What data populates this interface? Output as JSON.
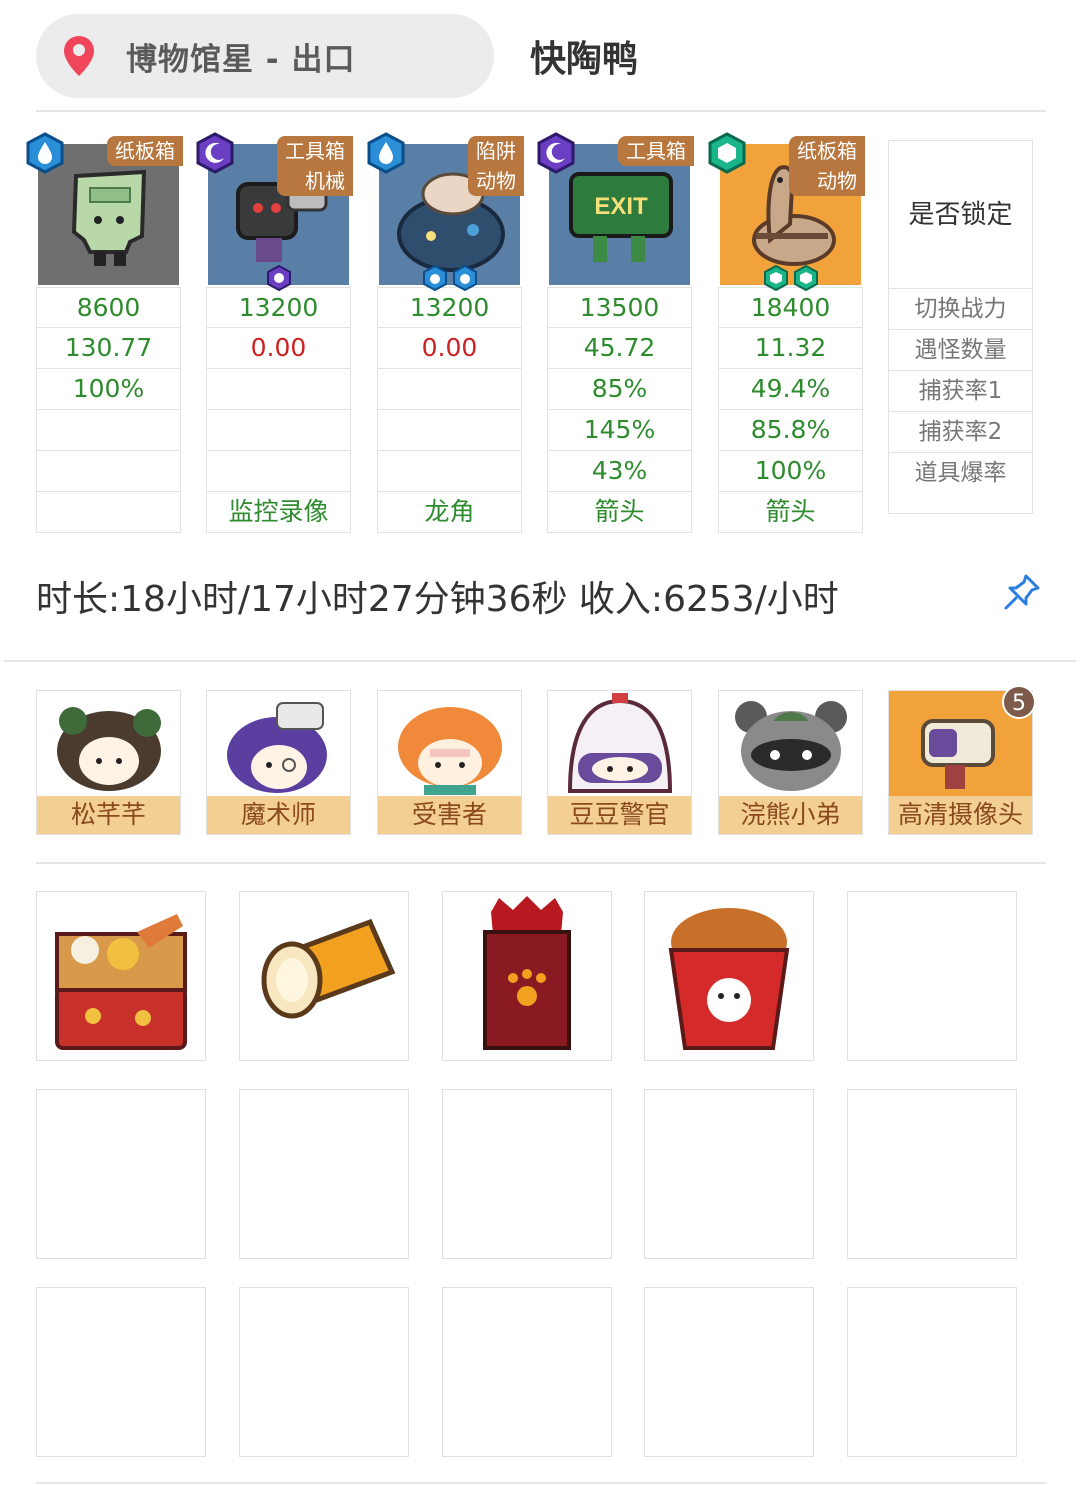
{
  "header": {
    "location": "博物馆星 - 出口",
    "target": "快陶鸭"
  },
  "monsters": [
    {
      "tag": "纸板箱",
      "rank": "blue",
      "power": "8600",
      "ratio": "130.77",
      "ratio_color": "green",
      "rows": [
        "100%",
        "",
        ""
      ],
      "drop": ""
    },
    {
      "tag": "工具箱\n机械",
      "rank": "purple",
      "power": "13200",
      "ratio": "0.00",
      "ratio_color": "red",
      "rows": [
        "",
        "",
        ""
      ],
      "drop": "监控录像"
    },
    {
      "tag": "陷阱\n动物",
      "rank": "blue",
      "power": "13200",
      "ratio": "0.00",
      "ratio_color": "red",
      "rows": [
        "",
        "",
        ""
      ],
      "drop": "龙角"
    },
    {
      "tag": "工具箱",
      "rank": "purple",
      "power": "13500",
      "ratio": "45.72",
      "ratio_color": "green",
      "rows": [
        "85%",
        "145%",
        "43%"
      ],
      "drop": "箭头"
    },
    {
      "tag": "纸板箱\n动物",
      "rank": "green",
      "power": "18400",
      "ratio": "11.32",
      "ratio_color": "green",
      "rows": [
        "49.4%",
        "85.8%",
        "100%"
      ],
      "drop": "箭头"
    }
  ],
  "labels": {
    "lock": "是否锁定",
    "power": "切换战力",
    "count": "遇怪数量",
    "catch1": "捕获率1",
    "catch2": "捕获率2",
    "drop": "道具爆率"
  },
  "summary": "时长:18小时/17小时27分钟36秒 收入:6253/小时",
  "team": [
    {
      "name": "松芊芊"
    },
    {
      "name": "魔术师"
    },
    {
      "name": "受害者"
    },
    {
      "name": "豆豆警官"
    },
    {
      "name": "浣熊小弟"
    },
    {
      "name": "高清摄像头",
      "count": "5"
    }
  ],
  "items": [
    "bento-box-icon",
    "flashlight-icon",
    "pet-food-bag-icon",
    "fried-chicken-bucket-icon"
  ],
  "colors": {
    "tag": "#b7773f",
    "green_text": "#2e8b2e",
    "red_text": "#cc2222",
    "name_bar": "#f3cf94"
  }
}
